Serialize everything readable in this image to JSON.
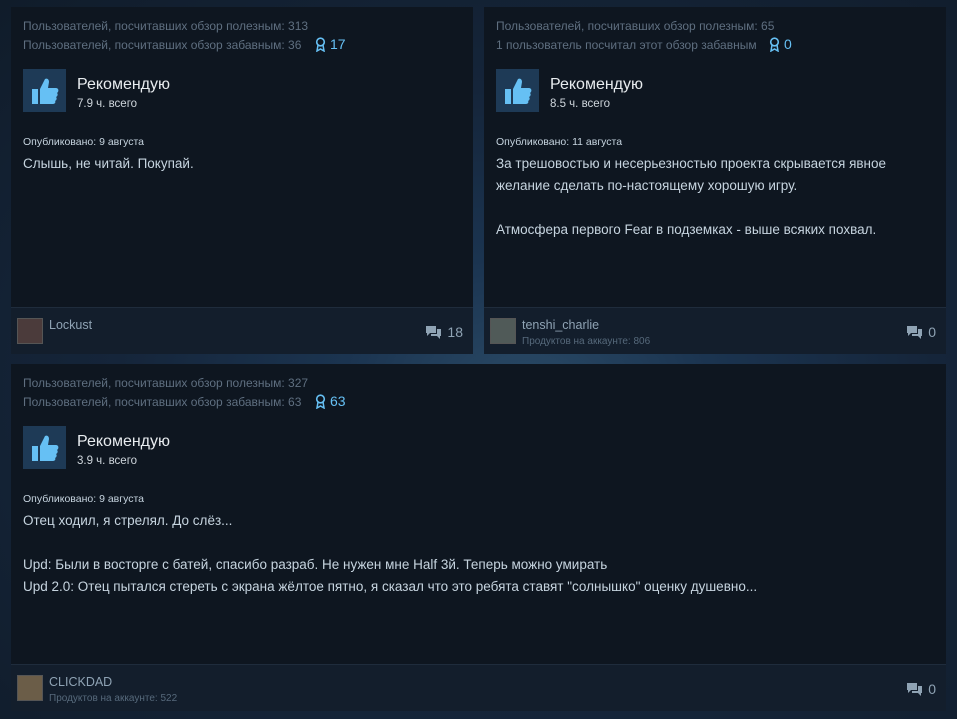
{
  "reviews": [
    {
      "helpful": "Пользователей, посчитавших обзор полезным: 313",
      "funny": "Пользователей, посчитавших обзор забавным: 36",
      "awards": "17",
      "verdict": "Рекомендую",
      "hours": "7.9 ч. всего",
      "posted": "Опубликовано: 9 августа",
      "lines": [
        "Слышь, не читай. Покупай."
      ],
      "user": "Lockust",
      "products": "",
      "comments": "18"
    },
    {
      "helpful": "Пользователей, посчитавших обзор полезным: 65",
      "funny": "1 пользователь посчитал этот обзор забавным",
      "awards": "0",
      "verdict": "Рекомендую",
      "hours": "8.5 ч. всего",
      "posted": "Опубликовано: 11 августа",
      "lines": [
        "За трешовостью и несерьезностью проекта скрывается явное",
        "желание сделать по-настоящему хорошую игру.",
        "",
        "Атмосфера первого Fear в подземках - выше всяких похвал."
      ],
      "user": "tenshi_charlie",
      "products": "Продуктов на аккаунте: 806",
      "comments": "0"
    },
    {
      "helpful": "Пользователей, посчитавших обзор полезным: 327",
      "funny": "Пользователей, посчитавших обзор забавным: 63",
      "awards": "63",
      "verdict": "Рекомендую",
      "hours": "3.9 ч. всего",
      "posted": "Опубликовано: 9 августа",
      "lines": [
        "Отец ходил, я стрелял. До слёз...",
        "",
        "Upd: Были в восторге с батей, спасибо разраб. Не нужен мне Half 3й. Теперь можно умирать",
        "Upd 2.0: Отец пытался стереть с экрана жёлтое пятно, я сказал что это ребята ставят \"солнышко\" оценку душевно..."
      ],
      "user": "CLICKDAD",
      "products": "Продуктов на аккаунте: 522",
      "comments": "0"
    }
  ],
  "icons": {
    "thumb": "thumbs-up-icon",
    "award": "award-ribbon-icon",
    "comment": "comment-bubbles-icon"
  },
  "colors": {
    "accent": "#66c0f4",
    "card": "#0e1620",
    "thumb_bg": "#1e3a56"
  }
}
